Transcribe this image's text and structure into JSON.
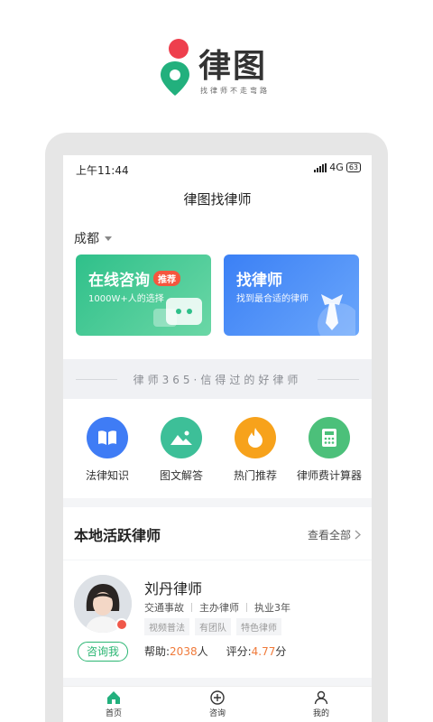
{
  "brand": {
    "title": "律图",
    "slogan": "找律师不走弯路",
    "colors": {
      "pin_red": "#ee3f4d",
      "pin_green": "#22b07d"
    }
  },
  "status_bar": {
    "time": "上午11:44",
    "network": "4G",
    "battery": "63"
  },
  "nav": {
    "title": "律图找律师"
  },
  "location": {
    "city": "成都"
  },
  "tiles": [
    {
      "title": "在线咨询",
      "badge": "推荐",
      "subtitle": "1000W+人的选择",
      "icon": "chat-bubbles-icon",
      "color": "#2fc08a"
    },
    {
      "title": "找律师",
      "subtitle": "找到最合适的律师",
      "icon": "tie-icon",
      "color": "#3b80f5"
    }
  ],
  "slogan_bar": {
    "text": "律师365·信得过的好律师"
  },
  "quick_links": [
    {
      "label": "法律知识",
      "icon": "book-icon",
      "color": "#3f7cf5"
    },
    {
      "label": "图文解答",
      "icon": "image-icon",
      "color": "#3dbf98"
    },
    {
      "label": "热门推荐",
      "icon": "fire-icon",
      "color": "#f7a21b"
    },
    {
      "label": "律师费计算器",
      "icon": "calculator-icon",
      "color": "#4cc07a"
    }
  ],
  "section": {
    "title": "本地活跃律师",
    "more_label": "查看全部"
  },
  "lawyer": {
    "name": "刘丹律师",
    "field": "交通事故",
    "role": "主办律师",
    "experience": "执业3年",
    "tags": [
      "视频普法",
      "有团队",
      "特色律师"
    ],
    "help_label": "帮助:",
    "help_count": "2038",
    "help_unit": "人",
    "rating_label": "评分:",
    "rating_value": "4.77",
    "rating_unit": "分",
    "consult_label": "咨询我"
  },
  "tabbar": [
    {
      "label": "首页",
      "icon": "home-icon"
    },
    {
      "label": "咨询",
      "icon": "plus-circle-icon"
    },
    {
      "label": "我的",
      "icon": "user-icon"
    }
  ]
}
